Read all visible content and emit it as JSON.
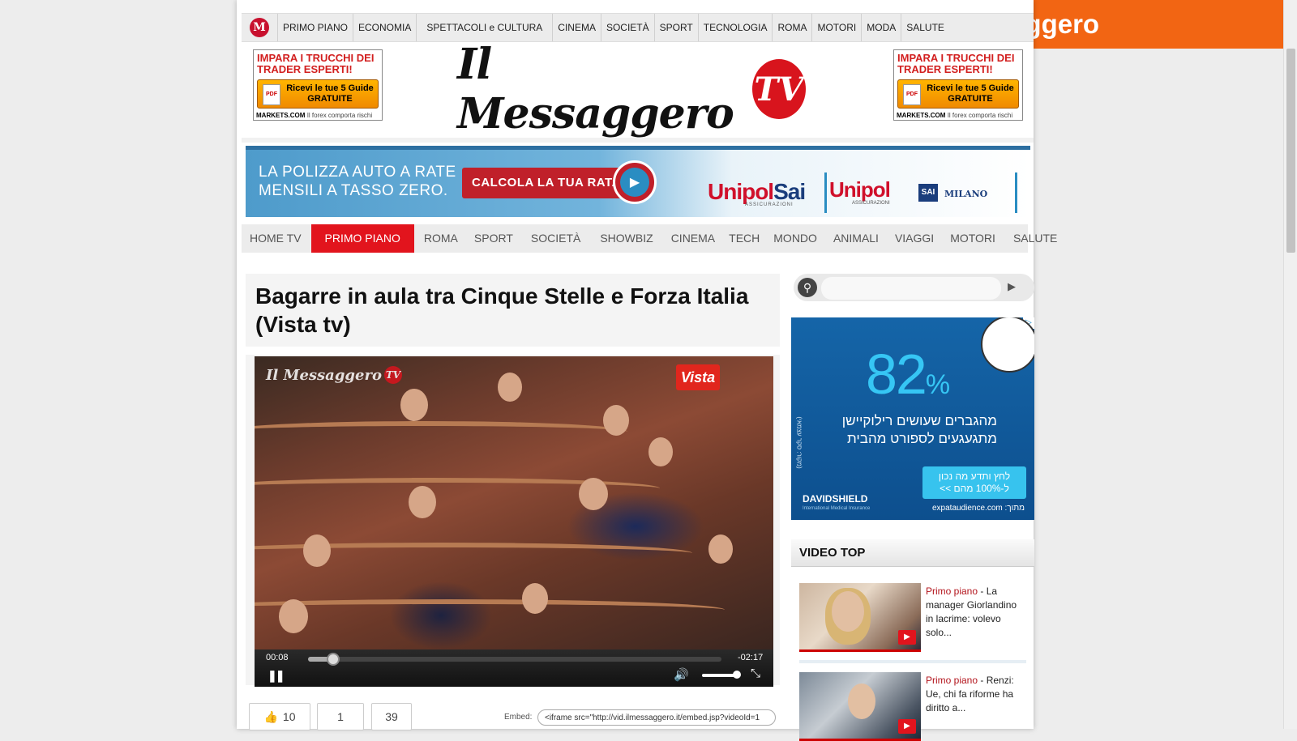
{
  "brand_banner": "Il Messaggero",
  "top_nav": {
    "logo": "M",
    "items": [
      "PRIMO PIANO",
      "ECONOMIA",
      "SPETTACOLI e CULTURA",
      "CINEMA",
      "SOCIETÀ",
      "SPORT",
      "TECNOLOGIA",
      "ROMA",
      "MOTORI",
      "MODA",
      "SALUTE"
    ]
  },
  "header": {
    "logo_text": "Il Messaggero",
    "logo_tv": "TV",
    "ad_left": {
      "headline": "IMPARA I TRUCCHI DEI TRADER ESPERTI!",
      "button": "Ricevi le tue 5 Guide GRATUITE",
      "pdf": "PDF",
      "footer_brand": "MARKETS.COM",
      "footer_note": "Il forex comporta rischi"
    },
    "ad_right": {
      "headline": "IMPARA I TRUCCHI DEI TRADER ESPERTI!",
      "button": "Ricevi le tue 5 Guide GRATUITE",
      "pdf": "PDF",
      "footer_brand": "MARKETS.COM",
      "footer_note": "Il forex comporta rischi"
    }
  },
  "banner_ad": {
    "line1": "LA POLIZZA AUTO A RATE",
    "line2": "MENSILI  A TASSO ZERO.",
    "cta": "CALCOLA LA TUA RATA",
    "brand1_a": "Unipol",
    "brand1_b": "Sai",
    "brand1_sub": "ASSICURAZIONI",
    "brand2": "Unipol",
    "brand2_sub": "ASSICURAZIONI",
    "brand3": "SAI",
    "brand4": "MILANO"
  },
  "main_nav": {
    "items": [
      "HOME TV",
      "PRIMO PIANO",
      "ROMA",
      "SPORT",
      "SOCIETÀ",
      "SHOWBIZ",
      "CINEMA",
      "TECH",
      "MONDO",
      "ANIMALI",
      "VIAGGI",
      "MOTORI",
      "SALUTE"
    ],
    "active": "PRIMO PIANO"
  },
  "article": {
    "title": "Bagarre in aula tra Cinque Stelle e Forza Italia (Vista tv)",
    "video": {
      "watermark": "Il Messaggero",
      "watermark_tv": "TV",
      "channel_badge": "Vista",
      "elapsed": "00:08",
      "remaining": "-02:17",
      "progress": 0.06,
      "volume": 0.9
    },
    "social": {
      "likes": "10",
      "shares": "1",
      "comments": "39"
    },
    "embed_label": "Embed:",
    "embed_code": "<iframe src=\"http://vid.ilmessaggero.it/embed.jsp?videoId=1"
  },
  "sidebar": {
    "search_placeholder": "",
    "ad": {
      "percent": "82",
      "percent_sign": "%",
      "hebrew_line1": "מהגברים שעושים רילוקיישן",
      "hebrew_line2": "מתגעגעים לספורט מהבית",
      "button_line1": "לחץ ותדע מה נכון",
      "button_line2": "ל-100% מהם  >>",
      "brand": "DAVIDSHIELD",
      "brand_sub": "International Medical Insurance",
      "sponsor": "expataudience.com :מתוך",
      "vertical_note": "(מקור: סקר עצמאי)"
    },
    "video_top": {
      "title": "VIDEO TOP",
      "items": [
        {
          "section": "Primo piano",
          "text": " - La manager Giorlandino in lacrime: volevo solo..."
        },
        {
          "section": "Primo piano",
          "text": " - Renzi: Ue, chi fa riforme ha diritto a..."
        }
      ]
    }
  }
}
